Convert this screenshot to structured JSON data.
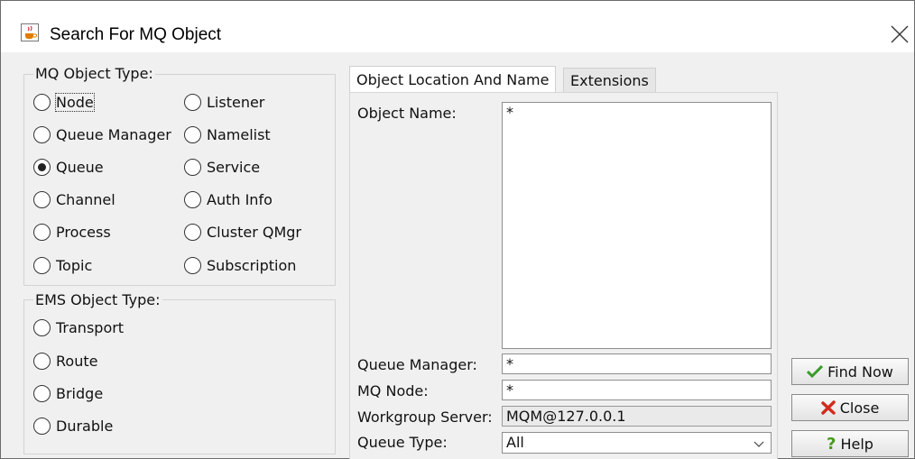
{
  "window": {
    "title": "Search For MQ Object",
    "app_icon": "java-cup-icon",
    "close_icon": "close-icon"
  },
  "mq_group": {
    "label": "MQ Object Type:",
    "options": [
      {
        "label": "Node",
        "checked": false
      },
      {
        "label": "Queue Manager",
        "checked": false
      },
      {
        "label": "Queue",
        "checked": true
      },
      {
        "label": "Channel",
        "checked": false
      },
      {
        "label": "Process",
        "checked": false
      },
      {
        "label": "Topic",
        "checked": false
      },
      {
        "label": "Listener",
        "checked": false
      },
      {
        "label": "Namelist",
        "checked": false
      },
      {
        "label": "Service",
        "checked": false
      },
      {
        "label": "Auth Info",
        "checked": false
      },
      {
        "label": "Cluster QMgr",
        "checked": false
      },
      {
        "label": "Subscription",
        "checked": false
      }
    ]
  },
  "ems_group": {
    "label": "EMS Object Type:",
    "options": [
      {
        "label": "Transport",
        "checked": false
      },
      {
        "label": "Route",
        "checked": false
      },
      {
        "label": "Bridge",
        "checked": false
      },
      {
        "label": "Durable",
        "checked": false
      }
    ]
  },
  "tabs": [
    {
      "label": "Object Location And Name",
      "active": true
    },
    {
      "label": "Extensions",
      "active": false
    }
  ],
  "form": {
    "object_name_label": "Object Name:",
    "object_name_value": "*",
    "queue_manager_label": "Queue Manager:",
    "queue_manager_value": "*",
    "mq_node_label": "MQ Node:",
    "mq_node_value": "*",
    "workgroup_server_label": "Workgroup Server:",
    "workgroup_server_value": "MQM@127.0.0.1",
    "queue_type_label": "Queue Type:",
    "queue_type_value": "All"
  },
  "buttons": {
    "find_now": "Find Now",
    "close": "Close",
    "help": "Help"
  },
  "colors": {
    "find_check": "#3c9a2e",
    "close_x": "#d22b1f",
    "help_q": "#4a9a1e"
  }
}
